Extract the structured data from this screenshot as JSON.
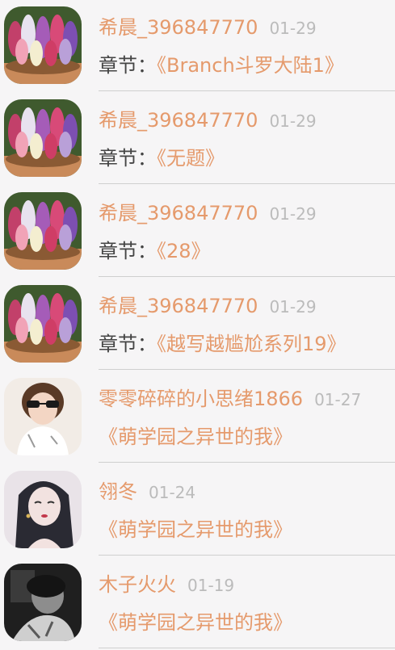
{
  "comments": [
    {
      "user": "希晨_396847770",
      "date": "01-29",
      "prefix": "章节：",
      "chapter": "《Branch斗罗大陆1》",
      "avatar": "hyacinth-flowers-avatar"
    },
    {
      "user": "希晨_396847770",
      "date": "01-29",
      "prefix": "章节：",
      "chapter": "《无题》",
      "avatar": "hyacinth-flowers-avatar"
    },
    {
      "user": "希晨_396847770",
      "date": "01-29",
      "prefix": "章节：",
      "chapter": "《28》",
      "avatar": "hyacinth-flowers-avatar"
    },
    {
      "user": "希晨_396847770",
      "date": "01-29",
      "prefix": "章节：",
      "chapter": "《越写越尴尬系列19》",
      "avatar": "hyacinth-flowers-avatar"
    },
    {
      "user": "零零碎碎的小思绪1866",
      "date": "01-27",
      "prefix": "",
      "chapter": "《萌学园之异世的我》",
      "avatar": "girl-sunglasses-avatar"
    },
    {
      "user": "翎冬",
      "date": "01-24",
      "prefix": "",
      "chapter": "《萌学园之异世的我》",
      "avatar": "anime-girl-avatar"
    },
    {
      "user": "木子火火",
      "date": "01-19",
      "prefix": "",
      "chapter": "《萌学园之异世的我》",
      "avatar": "dark-photo-avatar"
    }
  ]
}
